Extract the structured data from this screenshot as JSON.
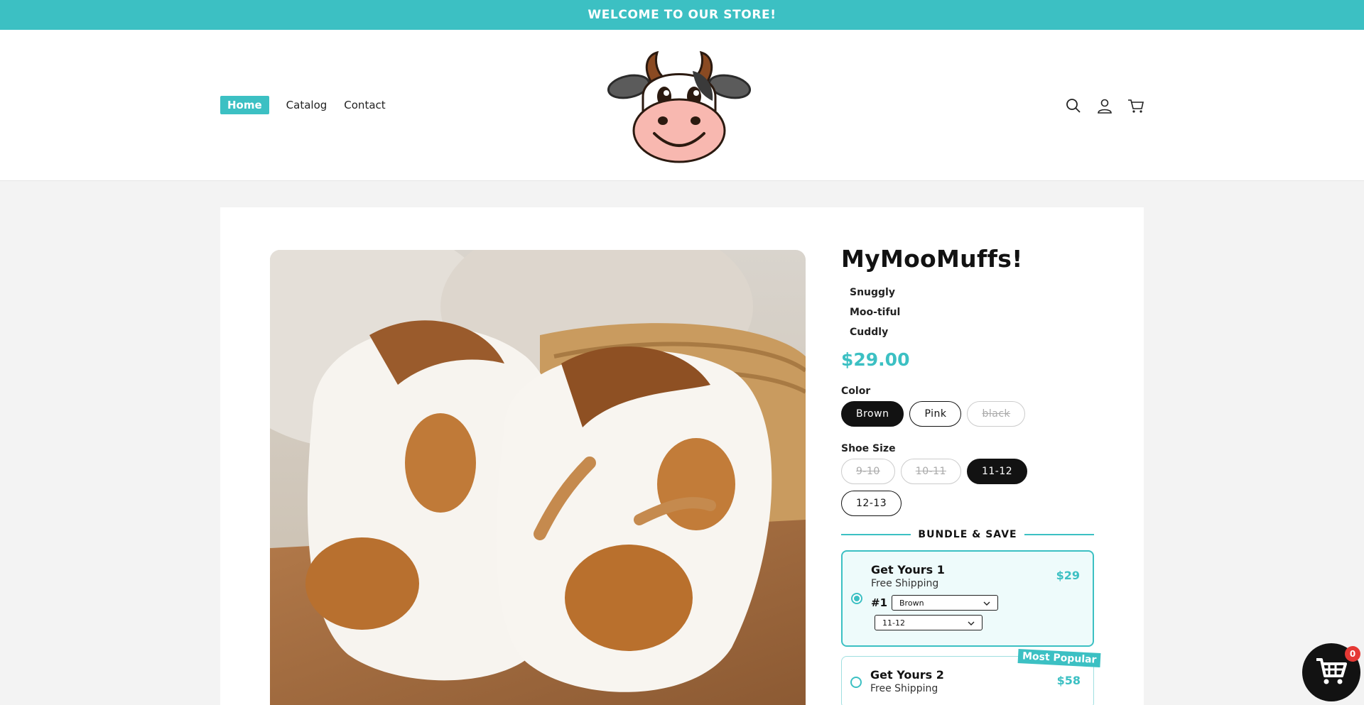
{
  "announcement": "WELCOME TO OUR STORE!",
  "nav": {
    "items": [
      "Home",
      "Catalog",
      "Contact"
    ]
  },
  "product": {
    "title": "MyMooMuffs!",
    "features": [
      "Snuggly",
      "Moo-tiful",
      "Cuddly"
    ],
    "price": "$29.00",
    "color_label": "Color",
    "colors": [
      {
        "label": "Brown",
        "state": "selected"
      },
      {
        "label": "Pink",
        "state": "available"
      },
      {
        "label": "black",
        "state": "sold-out"
      }
    ],
    "size_label": "Shoe Size",
    "sizes": [
      {
        "label": "9-10",
        "state": "sold-out"
      },
      {
        "label": "10-11",
        "state": "sold-out"
      },
      {
        "label": "11-12",
        "state": "selected"
      },
      {
        "label": "12-13",
        "state": "available"
      }
    ]
  },
  "bundle": {
    "heading": "BUNDLE & SAVE",
    "offers": [
      {
        "title": "Get Yours 1",
        "subtitle": "Free Shipping",
        "price": "$29",
        "item_number": "#1",
        "color_value": "Brown",
        "size_value": "11-12"
      },
      {
        "title": "Get Yours 2",
        "subtitle": "Free Shipping",
        "price": "$58",
        "badge": "Most Popular"
      }
    ]
  },
  "cart": {
    "count": "0"
  },
  "colors": {
    "accent": "#3cc0c3",
    "dark": "#121212",
    "badge_red": "#e53935"
  }
}
